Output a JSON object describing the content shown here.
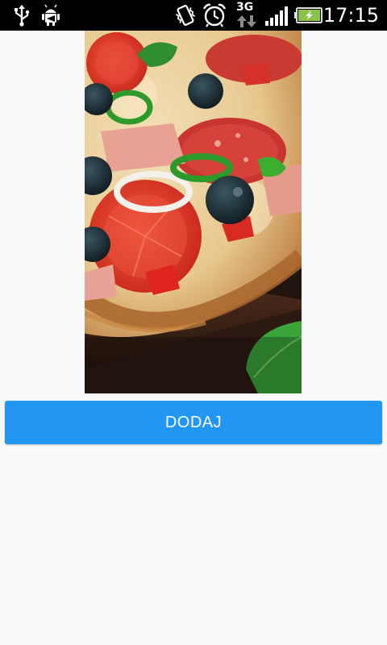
{
  "status_bar": {
    "time": "17:15",
    "network_label": "3G",
    "icons": [
      "usb-icon",
      "android-debug-icon",
      "vibrate-icon",
      "alarm-icon",
      "network-3g-icon",
      "signal-icon",
      "battery-charging-icon"
    ]
  },
  "main": {
    "image": {
      "subject": "pizza",
      "icon": "pizza-photo"
    },
    "add_button_label": "DODAJ"
  },
  "colors": {
    "accent": "#2196f3",
    "status_bar_bg": "#000000",
    "background": "#fafafa",
    "battery": "#8bc34a"
  }
}
